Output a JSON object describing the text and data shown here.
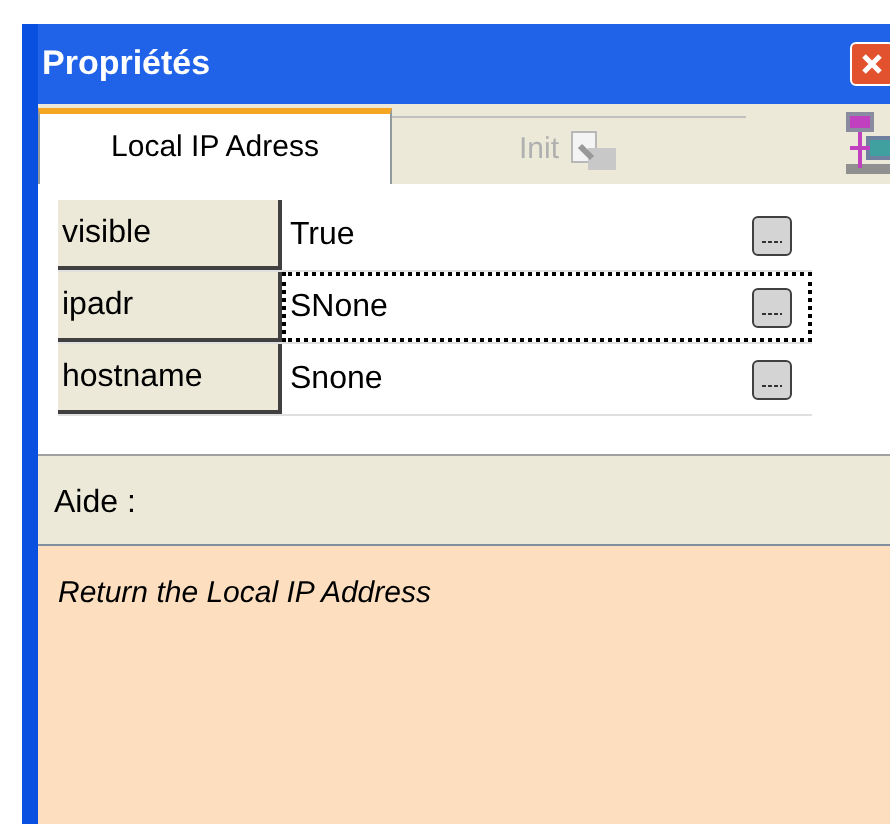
{
  "window": {
    "title": "Propriétés"
  },
  "tabs": [
    {
      "label": "Local IP Adress",
      "selected": true,
      "disabled": false
    },
    {
      "label": "Init",
      "selected": false,
      "disabled": true
    }
  ],
  "properties": [
    {
      "name": "visible",
      "value": "True",
      "selected": false
    },
    {
      "name": "ipadr",
      "value": "SNone",
      "selected": true
    },
    {
      "name": "hostname",
      "value": "Snone",
      "selected": false
    }
  ],
  "help": {
    "label": "Aide :",
    "text": "Return the Local IP Address"
  }
}
